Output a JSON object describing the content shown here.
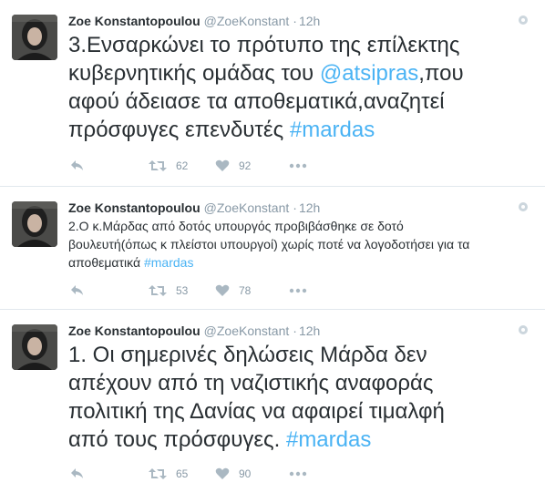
{
  "tweets": [
    {
      "author_name": "Zoe Konstantopoulou",
      "handle": "@ZoeKonstant",
      "separator": "·",
      "time": "12h",
      "text_lines": [
        "3.Ενσαρκώνει το πρότυπο της επίλεκτης",
        "κυβερνητικής ομάδας του ",
        "@atsipras",
        ",που",
        "αφού άδειασε τα αποθεματικά,αναζητεί",
        "πρόσφυγες επενδυτές ",
        "#mardas"
      ],
      "retweets": "62",
      "likes": "92"
    },
    {
      "author_name": "Zoe Konstantopoulou",
      "handle": "@ZoeKonstant",
      "separator": "·",
      "time": "12h",
      "text_lines": [
        "2.Ο κ.Μάρδας από δοτός υπουργός προβιβάσθηκε σε δοτό",
        "βουλευτή(όπως κ πλείστοι υπουργοί) χωρίς ποτέ να λογοδοτήσει για τα",
        "αποθεματικά ",
        "#mardas"
      ],
      "retweets": "53",
      "likes": "78"
    },
    {
      "author_name": "Zoe Konstantopoulou",
      "handle": "@ZoeKonstant",
      "separator": "·",
      "time": "12h",
      "text_lines": [
        "1. Οι σημερινές δηλώσεις Μάρδα δεν",
        "απέχουν από τη ναζιστικής αναφοράς",
        "πολιτική της Δανίας να αφαιρεί τιμαλφή",
        "από τους πρόσφυγες. ",
        "#mardas"
      ],
      "retweets": "65",
      "likes": "90"
    }
  ],
  "icons": {
    "reply": "reply-icon",
    "retweet": "retweet-icon",
    "like": "heart-icon",
    "more": "more-dots-icon",
    "menu": "tweet-menu-icon"
  },
  "colors": {
    "link": "#4ab3f4",
    "muted": "#8899a6",
    "text": "#292f33",
    "divider": "#e1e8ed"
  }
}
